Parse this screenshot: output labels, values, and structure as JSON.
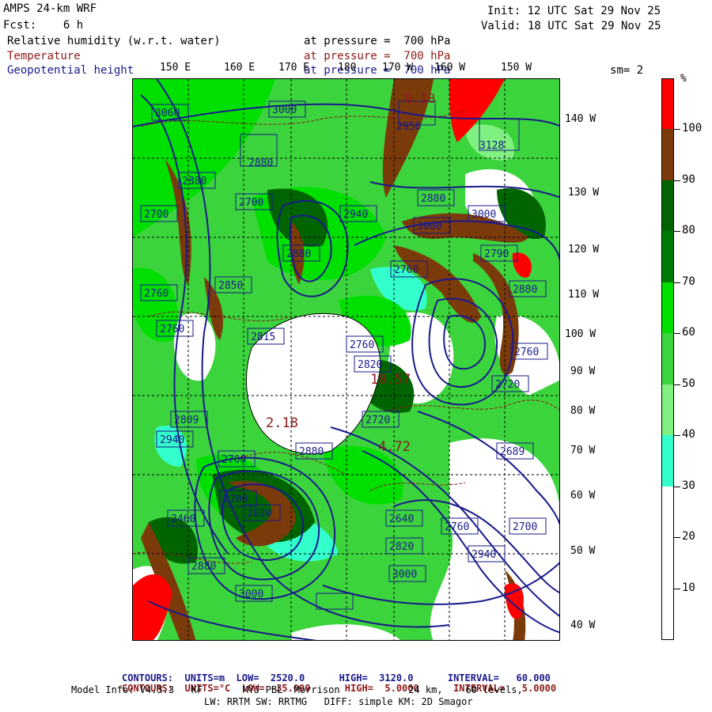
{
  "header": {
    "model": "AMPS 24-km WRF",
    "fcst": "Fcst:    6 h",
    "init": "Init: 12 UTC Sat 29 Nov 25",
    "valid": "Valid: 18 UTC Sat 29 Nov 25",
    "field1_name": "Relative humidity (w.r.t. water)",
    "field2_name": "Temperature",
    "field3_name": "Geopotential height",
    "field_level": "at pressure =  700 hPa",
    "smoothing": "sm= 2"
  },
  "lon_labels": [
    "150 E",
    "160 E",
    "170 E",
    "180",
    "170 W",
    "160 W",
    "150 W"
  ],
  "lat_labels": [
    "140 W",
    "130 W",
    "120 W",
    "110 W",
    "100 W",
    "90 W",
    "80 W",
    "70 W",
    "60 W",
    "50 W",
    "40 W"
  ],
  "colorbar": {
    "unit": "%",
    "labels": [
      "100",
      "90",
      "80",
      "70",
      "60",
      "50",
      "40",
      "30",
      "20",
      "10"
    ],
    "colors": [
      "#ff0000",
      "#7a3a0a",
      "#006400",
      "#007a00",
      "#00e000",
      "#3cd43c",
      "#80f080",
      "#33ffcc",
      "#ffffff",
      "#ffffff",
      "#ffffff"
    ]
  },
  "contour_labels": [
    "3060",
    "3000",
    "8.18",
    "2950",
    "3128",
    "2880",
    "2880",
    "2700",
    "2700",
    "2940",
    "2880",
    "3000",
    "3000",
    "2880",
    "2760",
    "2790",
    "2850",
    "2760",
    "2880",
    "2760",
    "2815",
    "2760",
    "2820",
    "2760",
    "2720",
    "2809",
    "2720",
    "2940",
    "2880",
    "2700",
    "2689",
    "2700",
    "2820",
    "2460",
    "2640",
    "2760",
    "2700",
    "2820",
    "2940",
    "2880",
    "3000",
    "3000"
  ],
  "contour_texts_red": [
    "2.18",
    "10.57",
    "4.72"
  ],
  "map_colors": {
    "bright_green": "#00e000",
    "dark_green": "#006400",
    "mid_green": "#3cd43c",
    "light_green": "#80f080",
    "cyan": "#33ffcc",
    "brown": "#7a3a0a",
    "red": "#ff0000",
    "contour_blue": "#1a1a8b",
    "contour_red": "#8b1a1a"
  },
  "footer": {
    "line1_label": "CONTOURS:",
    "line1_units": "UNITS=m",
    "line1_low": "LOW=  2520.0",
    "line1_high": "HIGH=  3120.0",
    "line1_interval": "INTERVAL=   60.000",
    "line2_label": "CONTOURS:",
    "line2_units": "UNITS=°C",
    "line2_low": "LOW= -35.000",
    "line2_high": "HIGH=  5.0000",
    "line2_interval": "INTERVAL=   5.0000",
    "line3": "Model Info: V4.3.3   KF       MYJ PBL  Morrison            24 km,    60 levels,",
    "line4": "LW: RRTM SW: RRTMG   DIFF: simple KM: 2D Smagor"
  }
}
